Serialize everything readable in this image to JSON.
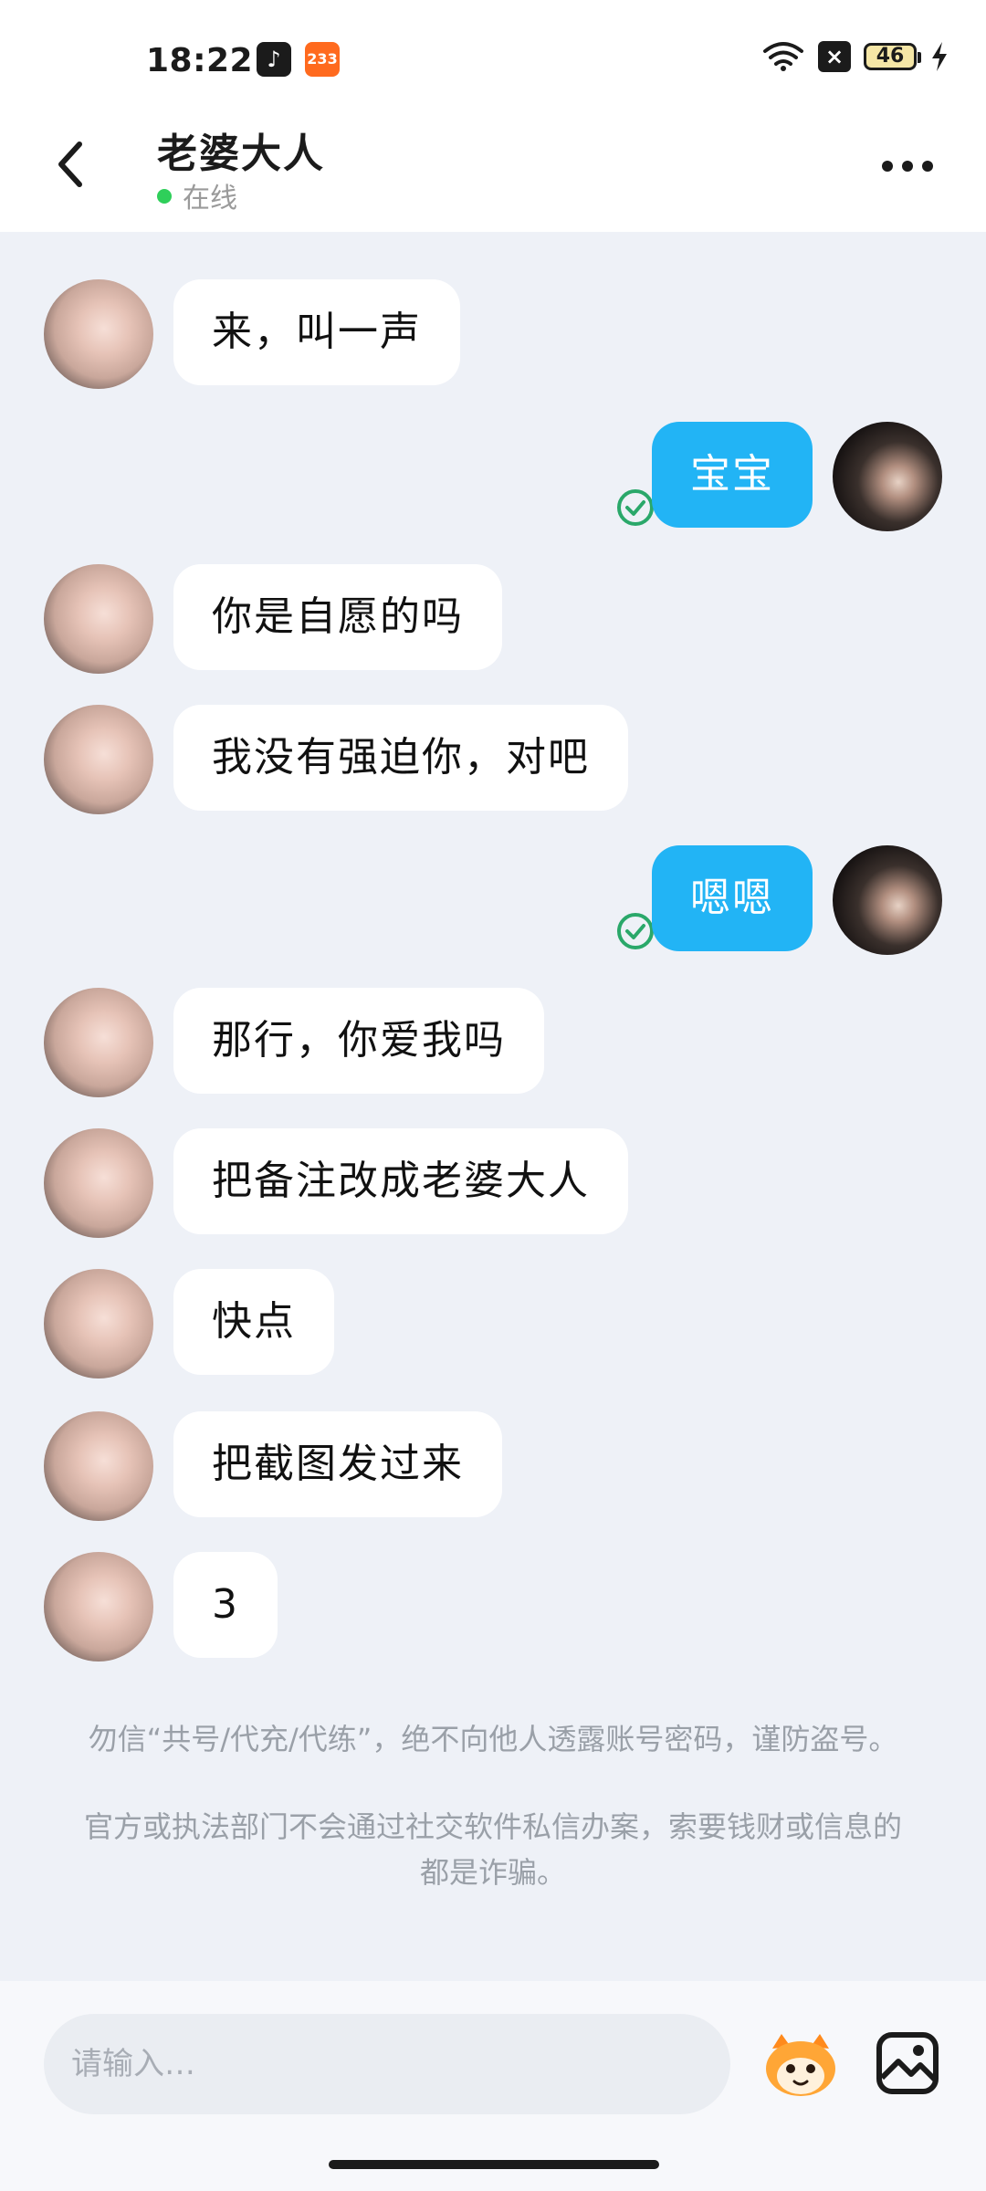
{
  "status_bar": {
    "time": "18:22",
    "app_icons": [
      "tiktok-icon",
      "app-233-icon"
    ],
    "app_233_label": "233",
    "battery_level": "46",
    "icons": [
      "wifi-icon",
      "notification-off-icon",
      "battery-icon",
      "charging-bolt-icon"
    ]
  },
  "header": {
    "contact_name": "老婆大人",
    "status": "在线",
    "status_color": "#2fcf5a",
    "icons": [
      "back-icon",
      "more-icon"
    ]
  },
  "messages": [
    {
      "from": "them",
      "text": "来，叫一声"
    },
    {
      "from": "me",
      "text": "宝宝",
      "status": "sent-check-icon"
    },
    {
      "from": "them",
      "text": "你是自愿的吗"
    },
    {
      "from": "them",
      "text": "我没有强迫你，对吧"
    },
    {
      "from": "me",
      "text": "嗯嗯",
      "status": "sent-check-icon"
    },
    {
      "from": "them",
      "text": "那行，你爱我吗"
    },
    {
      "from": "them",
      "text": "把备注改成老婆大人"
    },
    {
      "from": "them",
      "text": "快点"
    },
    {
      "from": "them",
      "text": "把截图发过来"
    },
    {
      "from": "them",
      "text": "3"
    }
  ],
  "notice": {
    "line1": "勿信“共号/代充/代练”，绝不向他人透露账号密码，谨防盗号。",
    "line2": "官方或执法部门不会通过社交软件私信办案，索要钱财或信息的都是诈骗。"
  },
  "input_bar": {
    "placeholder": "请输入…",
    "icons": [
      "sticker-icon",
      "image-icon"
    ]
  },
  "colors": {
    "outgoing_bubble": "#22b4f5",
    "incoming_bubble": "#ffffff",
    "chat_background": "#eef1f7"
  }
}
